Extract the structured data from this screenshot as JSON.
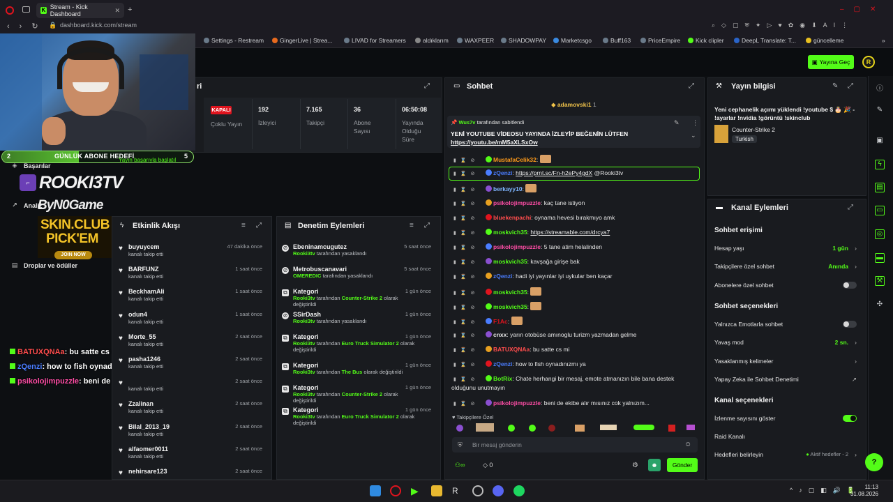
{
  "browser": {
    "tab_title": "Stream - Kick Dashboard",
    "url": "dashboard.kick.com/stream",
    "bookmarks": [
      "Settings - Restream",
      "GingerLive | Strea...",
      "LIVAD for Streamers",
      "aldıklarım",
      "WAXPEER",
      "SHADOWPAY",
      "Marketcsgo",
      "Buff163",
      "PriceEmpire",
      "Kick clipler",
      "DeepL Translate: T...",
      "güncelleme"
    ]
  },
  "header": {
    "go_live": "Yayına Geç",
    "avatar_letter": "R"
  },
  "overlay": {
    "goal_left": "2",
    "goal_title": "GÜNLÜK ABONE HEDEFİ",
    "goal_right": "5",
    "goal_fraction": 0.4,
    "goal_toast": "Yayın başarıyla başlatıl",
    "brand_name": "ROOKI3TV",
    "brand_by": "ByN0Game",
    "skin_line1": "SKIN.CLUB",
    "skin_line2": "PICK'EM",
    "join": "JOIN NOW",
    "chat": [
      {
        "user": "BATUXQNAa",
        "text": ": bu satte cs mi",
        "color": "#ff4d4d"
      },
      {
        "user": "zQenzi",
        "text": ": how to fish oynadımızmı ya",
        "color": "#4a7dff"
      },
      {
        "user": "psikolojimpuzzle",
        "text": ": beni de ekibe alır mısınız cok yalnızım...",
        "color": "#ff4da6"
      }
    ]
  },
  "left_nav": {
    "items": [
      "Başarılar",
      "Analiz",
      "Droplar ve ödüller"
    ]
  },
  "stream": {
    "title_fragment": "ri",
    "status": "KAPALI",
    "status_label": "Çoklu Yayın",
    "stats": [
      {
        "value": "192",
        "label": "İzleyici"
      },
      {
        "value": "7.165",
        "label": "Takipçi"
      },
      {
        "value": "36",
        "label": "Abone Sayısı"
      },
      {
        "value": "06:50:08",
        "label": "Yayında Olduğu Süre"
      }
    ]
  },
  "activity": {
    "title": "Etkinlik Akışı",
    "items": [
      {
        "name": "buyuycem",
        "sub": "kanalı takip etti",
        "time": "47 dakika önce"
      },
      {
        "name": "BARFUNZ",
        "sub": "kanalı takip etti",
        "time": "1 saat önce"
      },
      {
        "name": "BeckhamAli",
        "sub": "kanalı takip etti",
        "time": "1 saat önce"
      },
      {
        "name": "odun4",
        "sub": "kanalı takip etti",
        "time": "1 saat önce"
      },
      {
        "name": "Morte_55",
        "sub": "kanalı takip etti",
        "time": "2 saat önce"
      },
      {
        "name": "pasha1246",
        "sub": "kanalı takip etti",
        "time": "2 saat önce"
      },
      {
        "name": "",
        "sub": "kanalı takip etti",
        "time": "2 saat önce"
      },
      {
        "name": "Zzalinan",
        "sub": "kanalı takip etti",
        "time": "2 saat önce"
      },
      {
        "name": "Bilal_2013_19",
        "sub": "kanalı takip etti",
        "time": "2 saat önce"
      },
      {
        "name": "alfaomer0011",
        "sub": "kanalı takip etti",
        "time": "2 saat önce"
      },
      {
        "name": "nehirsare123",
        "sub": "",
        "time": "2 saat önce"
      }
    ]
  },
  "moderation": {
    "title": "Denetim Eylemleri",
    "items": [
      {
        "name": "Ebeninamcugutez",
        "actor": "Rooki3tv",
        "sub": "tarafından yasaklandı",
        "game": "",
        "tail": "",
        "time": "5 saat önce"
      },
      {
        "name": "Metrobuscanavari",
        "actor": "OMEREDIC",
        "sub": "tarafından yasaklandı",
        "game": "",
        "tail": "",
        "time": "5 saat önce"
      },
      {
        "name": "Kategori",
        "actor": "Rooki3tv",
        "sub": "tarafından",
        "game": "Counter-Strike 2",
        "tail": "olarak değiştirildi",
        "time": "1 gün önce"
      },
      {
        "name": "SSirDash",
        "actor": "Rooki3tv",
        "sub": "tarafından yasaklandı",
        "game": "",
        "tail": "",
        "time": "1 gün önce"
      },
      {
        "name": "Kategori",
        "actor": "Rooki3tv",
        "sub": "tarafından",
        "game": "Euro Truck Simulator 2",
        "tail": "olarak değiştirildi",
        "time": "1 gün önce"
      },
      {
        "name": "Kategori",
        "actor": "Rooki3tv",
        "sub": "tarafından",
        "game": "The Bus",
        "tail": "olarak değiştirildi",
        "time": "1 gün önce"
      },
      {
        "name": "Kategori",
        "actor": "Rooki3tv",
        "sub": "tarafından",
        "game": "Counter-Strike 2",
        "tail": "olarak değiştirildi",
        "time": "1 gün önce"
      },
      {
        "name": "Kategori",
        "actor": "Rooki3tv",
        "sub": "tarafından",
        "game": "Euro Truck Simulator 2",
        "tail": "olarak değiştirildi",
        "time": "1 gün önce"
      }
    ]
  },
  "chat": {
    "title": "Sohbet",
    "top_user": "adamovski1",
    "top_count": "1",
    "pinned_by": "Wus7v",
    "pinned_by_suffix": "tarafından sabitlendi",
    "pinned_text": "YENİ YOUTUBE VİDEOSU YAYINDA İZLEYİP BEĞENİN LÜTFEN",
    "pinned_link": "https://youtu.be/mM5aXLSxOw",
    "messages": [
      {
        "user": "MustafaCelik32",
        "text": "",
        "link": "",
        "color": "#ff9b1a"
      },
      {
        "user": "zQenzi",
        "text": " @Rooki3tv",
        "link": "https://prnt.sc/Fn-h2ePy4gdX",
        "color": "#4a7dff"
      },
      {
        "user": "berkayy10",
        "text": "",
        "link": "",
        "color": "#7fb5ff"
      },
      {
        "user": "psikolojimpuzzle",
        "text": "kaç tane istiyon",
        "link": "",
        "color": "#ff4da6"
      },
      {
        "user": "bluekenpachi",
        "text": "oynama hevesi bırakmıyo amk",
        "link": "",
        "color": "#ff4d4d"
      },
      {
        "user": "moskvich35",
        "text": "",
        "link": "https://streamable.com/drcya7",
        "color": "#53fc18"
      },
      {
        "user": "psikolojimpuzzle",
        "text": "5 tane atim helalinden",
        "link": "",
        "color": "#ff4da6"
      },
      {
        "user": "moskvich35",
        "text": "kavşağa girişe bak",
        "link": "",
        "color": "#53fc18"
      },
      {
        "user": "zQenzi",
        "text": "hadi iyi yayınlar iyi uykular ben kaçar",
        "link": "",
        "color": "#4a7dff"
      },
      {
        "user": "moskvich35",
        "text": "",
        "link": "",
        "color": "#53fc18"
      },
      {
        "user": "moskvich35",
        "text": "",
        "link": "",
        "color": "#53fc18"
      },
      {
        "user": "F1Ac",
        "text": "",
        "link": "",
        "color": "#e0141e"
      },
      {
        "user": "cnxx",
        "text": "yarın otobüse amınoglu turizm yazmadan gelme",
        "link": "",
        "color": "#e6e6e6"
      },
      {
        "user": "BATUXQNAa",
        "text": "bu satte cs mi",
        "link": "",
        "color": "#ff4d4d"
      },
      {
        "user": "zQenzi",
        "text": "how to fish oynadınızmı ya",
        "link": "",
        "color": "#4a7dff"
      },
      {
        "user": "BotRix",
        "text": "Chate herhangi bir mesaj, emote atmanızın bile bana destek",
        "link": "",
        "color": "#53fc18"
      },
      {
        "user": "",
        "text": "olduğunu unutmayın",
        "link": "",
        "color": "#e6e6e6"
      },
      {
        "user": "psikolojimpuzzle",
        "text": "beni de ekibe alır mısınız cok yalnızım...",
        "link": "",
        "color": "#ff4da6"
      }
    ],
    "emote_tab": "Takipçilere Özel",
    "input_placeholder": "Bir mesaj gönderin",
    "counter": "0",
    "send": "Gönder"
  },
  "stream_info": {
    "title": "Yayın bilgisi",
    "text": "Yeni cephanelik açımı yüklendi !youtube $ 🎂 🎉 - !ayarlar !nvidia !görüntü !skinclub",
    "category": "Counter-Strike 2",
    "language": "Turkish"
  },
  "channel_actions": {
    "title": "Kanal Eylemleri",
    "chat_access": "Sohbet erişimi",
    "account_age": {
      "label": "Hesap yaşı",
      "value": "1 gün"
    },
    "followers_only": {
      "label": "Takipçilere özel sohbet",
      "value": "Anında"
    },
    "subs_only": "Abonelere özel sohbet",
    "chat_options": "Sohbet seçenekleri",
    "emotes_only": "Yalnızca Emotlarla sohbet",
    "slow_mode": {
      "label": "Yavaş mod",
      "value": "2 sn."
    },
    "banned_words": "Yasaklanmış kelimeler",
    "ai_mod": "Yapay Zeka ile Sohbet Denetimi",
    "channel_options": "Kanal seçenekleri",
    "show_viewers": "İzlenme sayısını göster",
    "raid": "Raid Kanalı",
    "goals": {
      "label": "Hedefleri belirleyin",
      "value": "Aktif hedefler - 2"
    }
  },
  "taskbar": {
    "time": "11:13",
    "date": "31.08.2026"
  },
  "colors": {
    "accent": "#53fc18",
    "panel": "#191b1f",
    "bg": "#0d0f12",
    "live_red": "#e0141e"
  }
}
